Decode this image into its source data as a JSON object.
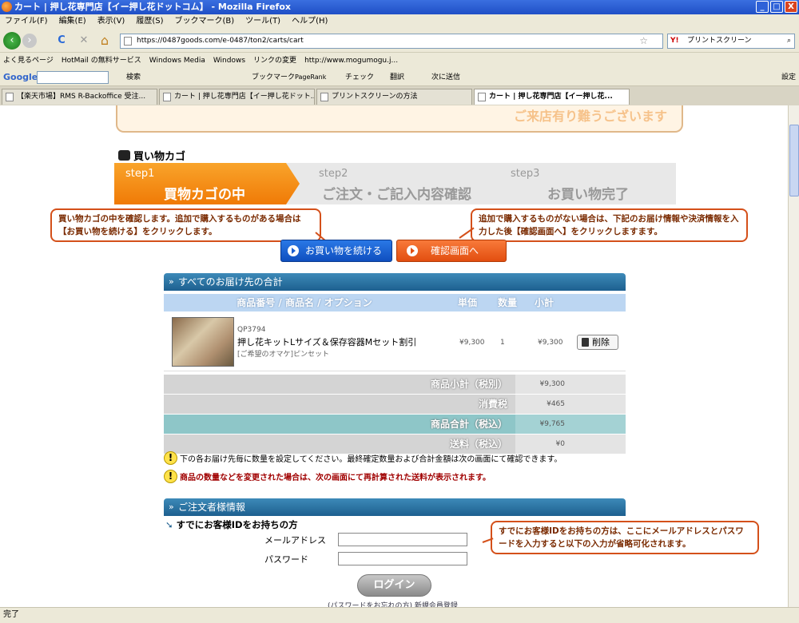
{
  "window": {
    "title": "カート | 押し花専門店【イー押し花ドットコム】 - Mozilla Firefox",
    "minimize": "_",
    "maximize": "□",
    "close": "X"
  },
  "menu": [
    "ファイル(F)",
    "編集(E)",
    "表示(V)",
    "履歴(S)",
    "ブックマーク(B)",
    "ツール(T)",
    "ヘルプ(H)"
  ],
  "nav": {
    "url": "https://0487goods.com/e-0487/ton2/carts/cart",
    "search_value": "プリントスクリーン",
    "reload": "C",
    "stop": "✕",
    "home": "⌂",
    "star": "☆"
  },
  "bookmarks": [
    "よく見るページ",
    "HotMail の無料サービス",
    "Windows Media",
    "Windows",
    "リンクの変更",
    "http://www.mogumogu.j..."
  ],
  "google_bar": {
    "logo": "Google",
    "search_btn": "検索",
    "bookmark": "ブックマーク",
    "pagerank": "PageRank",
    "check": "チェック",
    "translate": "翻訳",
    "send": "次に送信",
    "settings": "設定"
  },
  "tabs": [
    {
      "label": "【楽天市場】RMS R-Backoffice 受注..."
    },
    {
      "label": "カート | 押し花専門店【イー押し花ドット..."
    },
    {
      "label": "プリントスクリーンの方法"
    },
    {
      "label": "カート | 押し花専門店【イー押し花..."
    }
  ],
  "status": "完了",
  "page": {
    "banner": "ご来店有り難うございます",
    "cart_heading": "買い物カゴ",
    "steps": [
      {
        "label": "step1",
        "title": "買物カゴの中"
      },
      {
        "label": "step2",
        "title": "ご注文・ご記入内容確認"
      },
      {
        "label": "step3",
        "title": "お買い物完了"
      }
    ],
    "callouts": {
      "left": "買い物カゴの中を確認します。追加で購入するものがある場合は【お買い物を続ける】をクリックします。",
      "right": "追加で購入するものがない場合は、下記のお届け情報や決済情報を入力した後【確認画面へ】をクリックしますます。",
      "login": "すでにお客様IDをお持ちの方は、ここにメールアドレスとパスワードを入力すると以下の入力が省略可化されます。"
    },
    "buttons": {
      "continue": "お買い物を続ける",
      "confirm": "確認画面へ",
      "delete": "削除",
      "login": "ログイン"
    },
    "section_total": "すべてのお届け先の合計",
    "table_headers": [
      "商品番号 / 商品名 / オプション",
      "単価",
      "数量",
      "小計"
    ],
    "product": {
      "code": "QP3794",
      "name": "押し花キットLサイズ＆保存容器Mセット割引",
      "option": "[ご希望のオマケ]ピンセット",
      "price": "¥9,300",
      "qty": "1",
      "subtotal": "¥9,300"
    },
    "summary": [
      {
        "label": "商品小計（税別）",
        "value": "¥9,300"
      },
      {
        "label": "消費税",
        "value": "¥465"
      },
      {
        "label": "商品合計（税込）",
        "value": "¥9,765"
      },
      {
        "label": "送料（税込）",
        "value": "¥0"
      }
    ],
    "notes": [
      "下の各お届け先毎に数量を設定してください。最終確定数量および合計金額は次の画面にて確認できます。",
      "商品の数量などを変更された場合は、次の画面にて再計算された送料が表示されます。"
    ],
    "section_orderer": "ご注文者様情報",
    "existing_id": "すでにお客様IDをお持ちの方",
    "email_label": "メールアドレス",
    "password_label": "パスワード",
    "footer_links": "(パスワードをお忘れの方) 新規会員登録"
  }
}
